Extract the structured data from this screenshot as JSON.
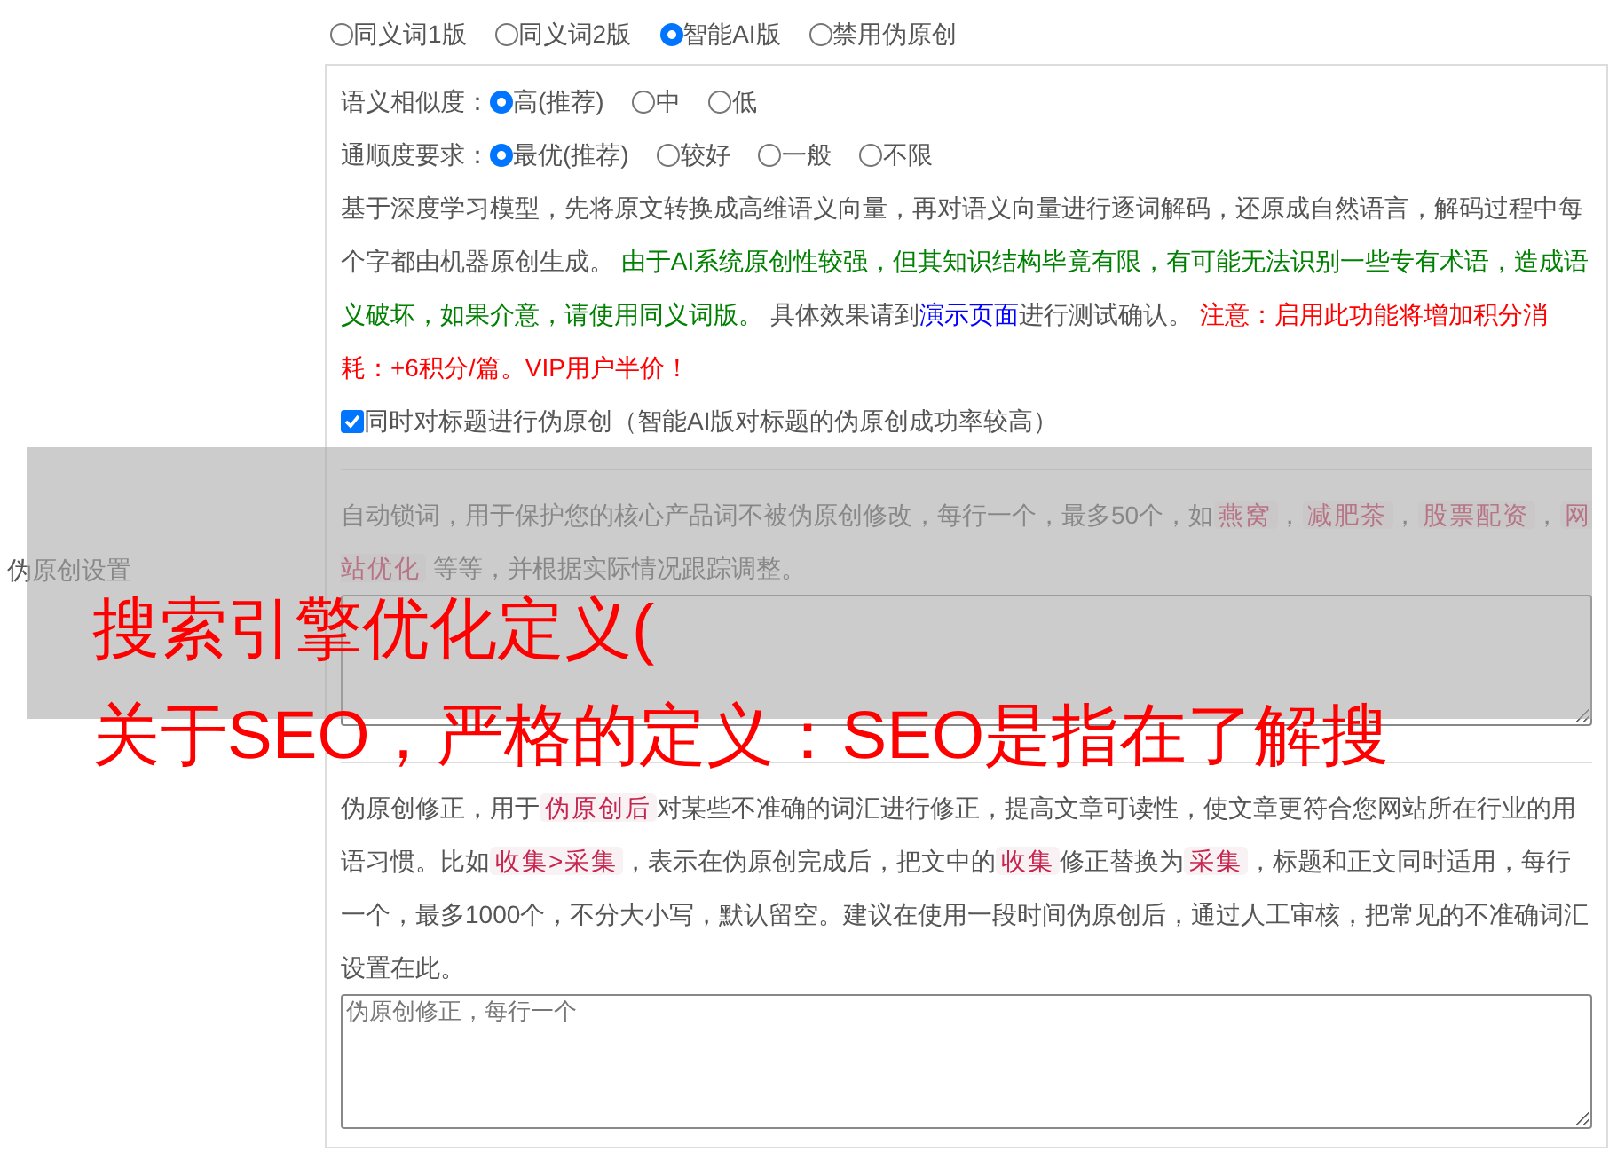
{
  "side_label": "伪原创设置",
  "modes": [
    {
      "label": "同义词1版",
      "selected": false
    },
    {
      "label": "同义词2版",
      "selected": false
    },
    {
      "label": "智能AI版",
      "selected": true
    },
    {
      "label": "禁用伪原创",
      "selected": false
    }
  ],
  "similarity": {
    "label": "语义相似度：",
    "options": [
      {
        "label": "高(推荐)",
        "selected": true
      },
      {
        "label": "中",
        "selected": false
      },
      {
        "label": "低",
        "selected": false
      }
    ]
  },
  "fluency": {
    "label": "通顺度要求：",
    "options": [
      {
        "label": "最优(推荐)",
        "selected": true
      },
      {
        "label": "较好",
        "selected": false
      },
      {
        "label": "一般",
        "selected": false
      },
      {
        "label": "不限",
        "selected": false
      }
    ]
  },
  "ai_description": [
    {
      "kind": "plain",
      "text": "基于深度学习模型，先将原文转换成高维语义向量，再对语义向量进行逐词解码，还原成自然语言，解码过程中每个字都由机器原创生成。 "
    },
    {
      "kind": "green",
      "text": "由于AI系统原创性较强，但其知识结构毕竟有限，有可能无法识别一些专有术语，造成语义破坏，如果介意，请使用同义词版。"
    },
    {
      "kind": "plain",
      "text": " 具体效果请到"
    },
    {
      "kind": "link",
      "text": "演示页面"
    },
    {
      "kind": "plain",
      "text": "进行测试确认。 "
    },
    {
      "kind": "red",
      "text": "注意：启用此功能将增加积分消耗：+6积分/篇。VIP用户半价！"
    }
  ],
  "title_option": {
    "label": "同时对标题进行伪原创（智能AI版对标题的伪原创成功率较高）",
    "checked": true
  },
  "lock_words": {
    "description": [
      {
        "kind": "plain",
        "text": "自动锁词，用于保护您的核心产品词不被伪原创修改，每行一个，最多50个，如"
      },
      {
        "kind": "code",
        "text": "燕窝"
      },
      {
        "kind": "plain",
        "text": "，"
      },
      {
        "kind": "code",
        "text": "减肥茶"
      },
      {
        "kind": "plain",
        "text": "，"
      },
      {
        "kind": "code",
        "text": "股票配资"
      },
      {
        "kind": "plain",
        "text": "，"
      },
      {
        "kind": "code",
        "text": "网站优化"
      },
      {
        "kind": "plain",
        "text": " 等等，并根据实际情况跟踪调整。"
      }
    ]
  },
  "corrections": {
    "description": [
      {
        "kind": "plain",
        "text": "伪原创修正，用于"
      },
      {
        "kind": "code",
        "text": "伪原创后"
      },
      {
        "kind": "plain",
        "text": "对某些不准确的词汇进行修正，提高文章可读性，使文章更符合您网站所在行业的用语习惯。比如"
      },
      {
        "kind": "code",
        "text": "收集>采集"
      },
      {
        "kind": "plain",
        "text": "，表示在伪原创完成后，把文中的"
      },
      {
        "kind": "code",
        "text": "收集"
      },
      {
        "kind": "plain",
        "text": "修正替换为"
      },
      {
        "kind": "code",
        "text": "采集"
      },
      {
        "kind": "plain",
        "text": "，标题和正文同时适用，每行一个，最多1000个，不分大小写，默认留空。建议在使用一段时间伪原创后，通过人工审核，把常见的不准确词汇设置在此。"
      }
    ],
    "placeholder": "伪原创修正，每行一个"
  },
  "overlay": {
    "lines": [
      "搜索引擎优化定义(",
      "关于SEO，严格的定义：SEO是指在了解搜"
    ]
  }
}
